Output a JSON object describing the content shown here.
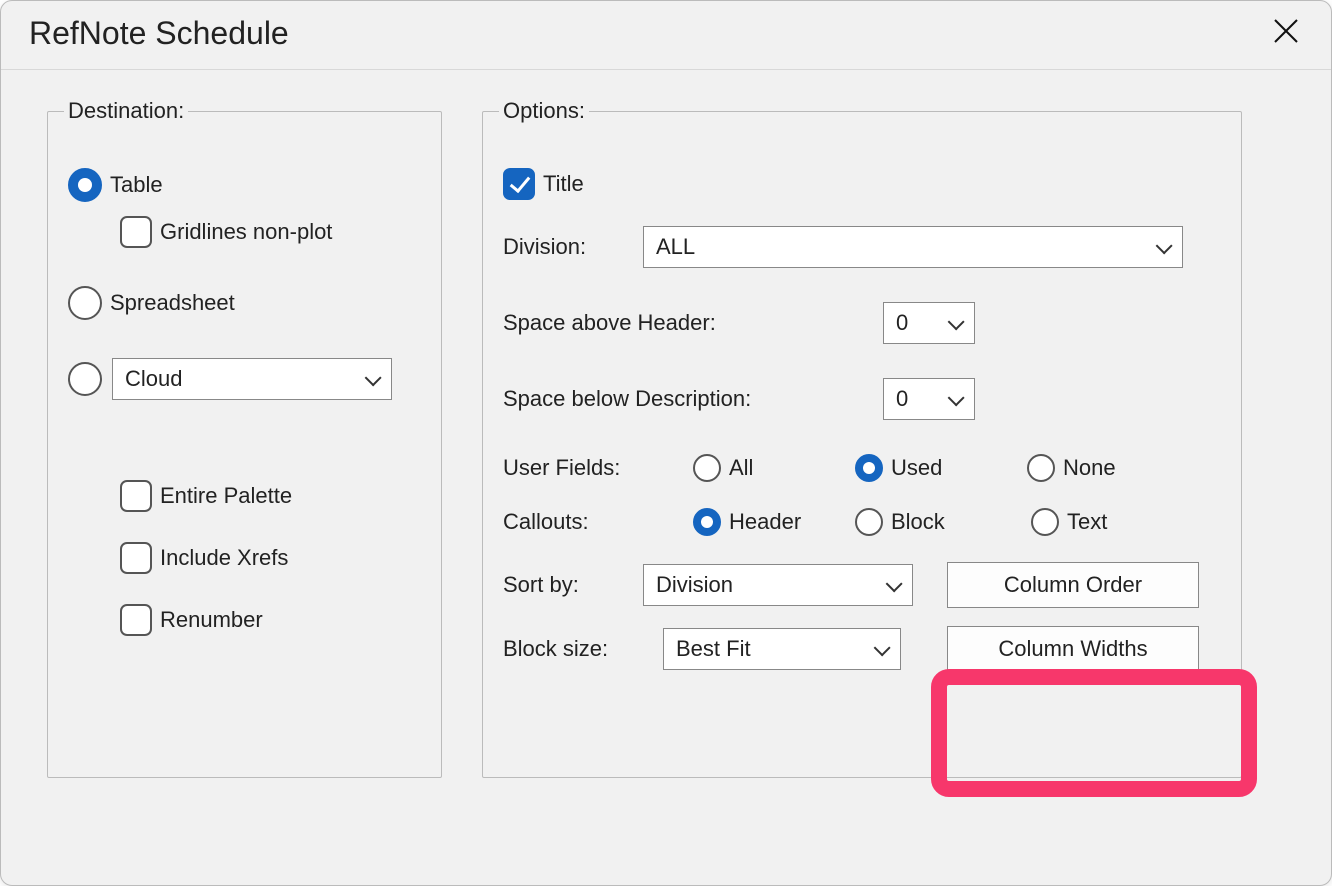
{
  "dialog": {
    "title": "RefNote Schedule"
  },
  "destination": {
    "legend": "Destination:",
    "table_label": "Table",
    "gridlines_label": "Gridlines non-plot",
    "spreadsheet_label": "Spreadsheet",
    "cloud_value": "Cloud",
    "entire_palette_label": "Entire Palette",
    "include_xrefs_label": "Include Xrefs",
    "renumber_label": "Renumber"
  },
  "options": {
    "legend": "Options:",
    "title_label": "Title",
    "division_label": "Division:",
    "division_value": "ALL",
    "space_above_header_label": "Space above Header:",
    "space_above_header_value": "0",
    "space_below_desc_label": "Space below Description:",
    "space_below_desc_value": "0",
    "user_fields_label": "User Fields:",
    "user_fields_all": "All",
    "user_fields_used": "Used",
    "user_fields_none": "None",
    "callouts_label": "Callouts:",
    "callouts_header": "Header",
    "callouts_block": "Block",
    "callouts_text": "Text",
    "sort_by_label": "Sort by:",
    "sort_by_value": "Division",
    "column_order_button": "Column Order",
    "block_size_label": "Block size:",
    "block_size_value": "Best Fit",
    "column_widths_button": "Column Widths"
  }
}
